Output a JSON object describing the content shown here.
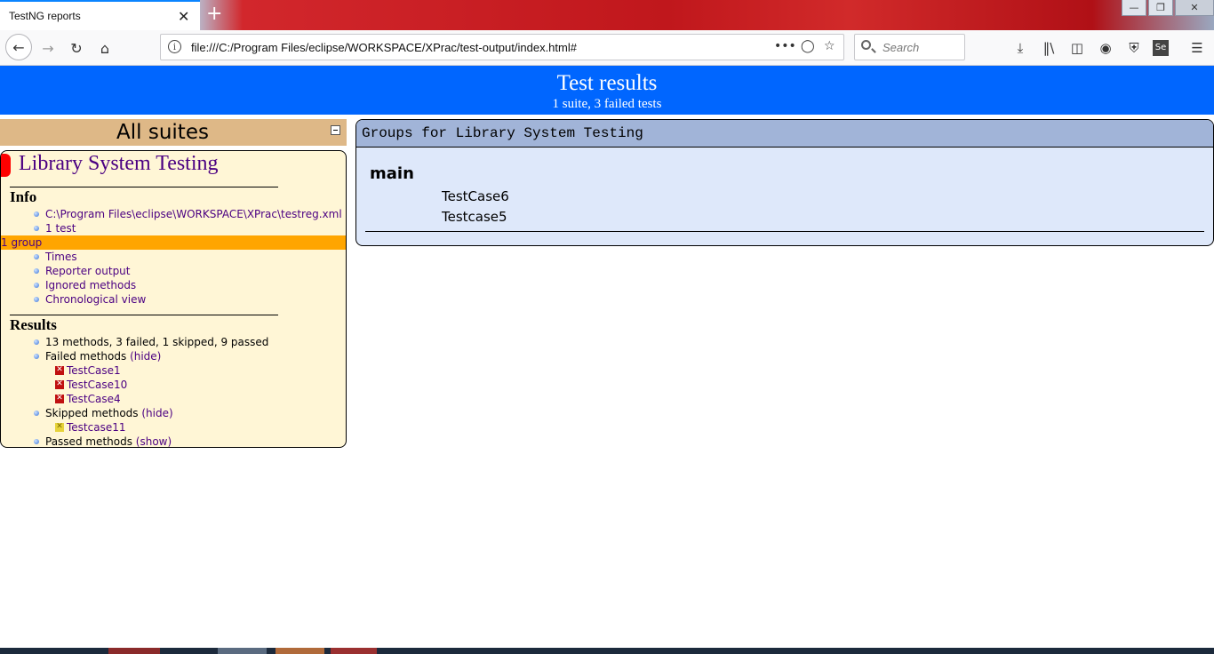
{
  "browser": {
    "tab_title": "TestNG reports",
    "tab_close": "✕",
    "new_tab": "+",
    "url": "file:///C:/Program Files/eclipse/WORKSPACE/XPrac/test-output/index.html#",
    "search_placeholder": "Search",
    "window_buttons": [
      "—",
      "❐",
      "✕"
    ],
    "icons": [
      "back-icon",
      "forward-icon",
      "reload-icon",
      "home-icon",
      "info-icon",
      "more-icon",
      "pocket-icon",
      "bookmark-star-icon",
      "search-icon",
      "download-icon",
      "library-icon",
      "sidebar-icon",
      "account-icon",
      "shield-icon",
      "selenium-icon",
      "menu-icon"
    ]
  },
  "header": {
    "title": "Test results",
    "subtitle": "1 suite, 3 failed tests"
  },
  "navigator": {
    "all_suites": "All suites",
    "suite_name": "Library System Testing",
    "info_title": "Info",
    "info_items": [
      "C:\\Program Files\\eclipse\\WORKSPACE\\XPrac\\testreg.xml",
      "1 test",
      "1 group",
      "Times",
      "Reporter output",
      "Ignored methods",
      "Chronological view"
    ],
    "results_title": "Results",
    "summary": "13 methods, 3 failed, 1 skipped, 9 passed",
    "failed_label": "Failed methods",
    "failed_toggle": "(hide)",
    "failed_methods": [
      "TestCase1",
      "TestCase10",
      "TestCase4"
    ],
    "skipped_label": "Skipped methods",
    "skipped_toggle": "(hide)",
    "skipped_methods": [
      "Testcase11"
    ],
    "passed_label": "Passed methods",
    "passed_toggle": "(show)"
  },
  "main": {
    "panel_title": "Groups for Library System Testing",
    "group_name": "main",
    "methods": [
      "TestCase6",
      "Testcase5"
    ]
  },
  "colors": {
    "header_bg": "#0066ff",
    "navigator_header_bg": "#deb887",
    "suite_bg": "#fff6d6",
    "selected_bg": "#ffa500",
    "link": "#4b0082",
    "panel_bg": "#dee8fa",
    "panel_head_bg": "#a1b4d8",
    "failed": "#c01010",
    "skipped": "#e6d23a"
  }
}
